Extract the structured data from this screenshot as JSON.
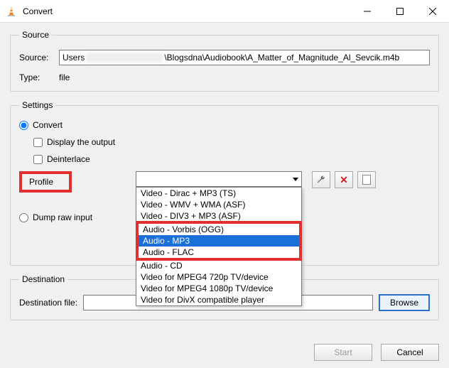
{
  "window": {
    "title": "Convert",
    "min": "—",
    "max": "☐",
    "close": "✕"
  },
  "source": {
    "legend": "Source",
    "source_label": "Source:",
    "path_prefix": "Users",
    "path_suffix": "\\Blogsdna\\Audiobook\\A_Matter_of_Magnitude_Al_Sevcik.m4b",
    "type_label": "Type:",
    "type_value": "file"
  },
  "settings": {
    "legend": "Settings",
    "convert_label": "Convert",
    "display_output_label": "Display the output",
    "deinterlace_label": "Deinterlace",
    "profile_label": "Profile",
    "dropdown": {
      "items": [
        "Video - Dirac + MP3 (TS)",
        "Video - WMV + WMA (ASF)",
        "Video - DIV3 + MP3 (ASF)",
        "Audio - Vorbis (OGG)",
        "Audio - MP3",
        "Audio - FLAC",
        "Audio - CD",
        "Video for MPEG4 720p TV/device",
        "Video for MPEG4 1080p TV/device",
        "Video for DivX compatible player"
      ],
      "selected_index": 4
    },
    "dump_label": "Dump raw input"
  },
  "destination": {
    "legend": "Destination",
    "file_label": "Destination file:",
    "browse_label": "Browse"
  },
  "footer": {
    "start": "Start",
    "cancel": "Cancel"
  },
  "icons": {
    "wrench": "wrench-icon",
    "delete": "delete-icon",
    "new": "new-profile-icon"
  }
}
